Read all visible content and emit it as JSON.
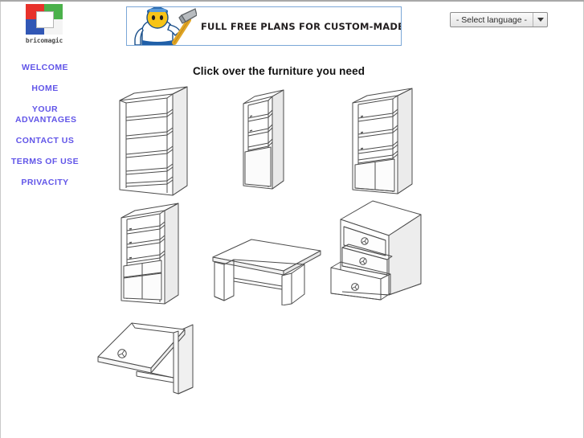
{
  "site": {
    "logo_word": "bricomagic",
    "logo_colors": {
      "top_left": "#e8322b",
      "top_right": "#4bb14b",
      "bottom_left": "#3157b5",
      "bottom_right": "#f2f2f2",
      "center": "#ffffff"
    }
  },
  "banner": {
    "text": "FULL FREE PLANS FOR CUSTOM-MADE FURNITURE",
    "border_color": "#7ba7d7",
    "figure_icon": "handyman-with-hammer-icon"
  },
  "language_selector": {
    "selected": "- Select language -",
    "arrow_icon": "chevron-down-icon"
  },
  "sidebar": {
    "link_color": "#6155e8",
    "items": [
      {
        "label": "WELCOME"
      },
      {
        "label": "HOME"
      },
      {
        "label": "YOUR ADVANTAGES"
      },
      {
        "label": "CONTACT US"
      },
      {
        "label": "TERMS OF USE"
      },
      {
        "label": "PRIVACITY"
      }
    ]
  },
  "main": {
    "heading": "Click over the furniture you need",
    "furniture": [
      {
        "name": "open-bookshelf-five-shelves",
        "alt": "Open bookshelf with five shelves"
      },
      {
        "name": "narrow-tall-cabinet-shelves-over-door",
        "alt": "Narrow tall cabinet, open shelves above a closed base"
      },
      {
        "name": "bookcase-with-two-door-base",
        "alt": "Bookcase with open shelves over a two-door base"
      },
      {
        "name": "bookcase-with-drawers-and-doors",
        "alt": "Bookcase with open shelves, drawers and two-door base"
      },
      {
        "name": "writing-desk",
        "alt": "Writing desk with panel legs"
      },
      {
        "name": "three-drawer-chest",
        "alt": "Three drawer chest with bottom drawer open"
      },
      {
        "name": "wall-cabinet-drop-down-door",
        "alt": "Wall cabinet with drop-down door"
      }
    ]
  }
}
